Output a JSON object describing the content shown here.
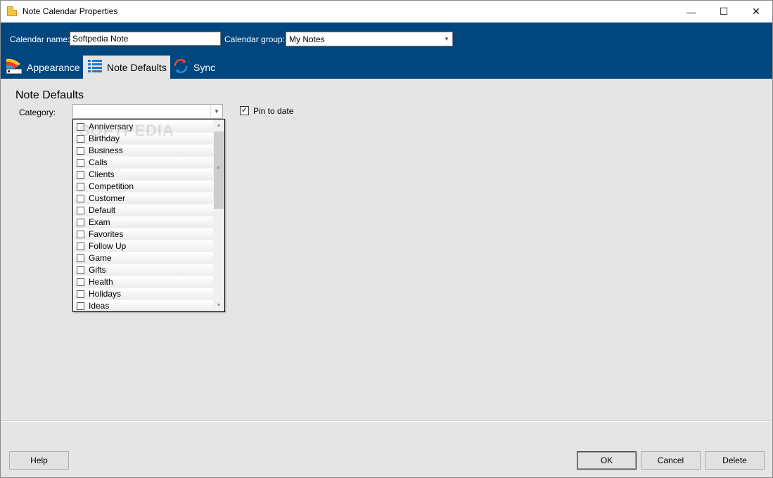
{
  "window": {
    "title": "Note Calendar Properties",
    "controls": {
      "minimize": "—",
      "maximize": "☐",
      "close": "✕"
    }
  },
  "header": {
    "calendar_name_label": "Calendar name:",
    "calendar_name_value": "Softpedia Note",
    "calendar_group_label": "Calendar group:",
    "calendar_group_value": "My Notes"
  },
  "tabs": [
    {
      "label": "Appearance",
      "icon": "palette-icon",
      "active": false
    },
    {
      "label": "Note Defaults",
      "icon": "list-icon",
      "active": true
    },
    {
      "label": "Sync",
      "icon": "sync-icon",
      "active": false
    }
  ],
  "content": {
    "section_title": "Note Defaults",
    "category_label": "Category:",
    "category_value": "",
    "pin_to_date_label": "Pin to date",
    "pin_to_date_checked": true,
    "categories": [
      {
        "label": "Anniversary",
        "checked": false
      },
      {
        "label": "Birthday",
        "checked": false
      },
      {
        "label": "Business",
        "checked": false
      },
      {
        "label": "Calls",
        "checked": false
      },
      {
        "label": "Clients",
        "checked": false
      },
      {
        "label": "Competition",
        "checked": false
      },
      {
        "label": "Customer",
        "checked": false
      },
      {
        "label": "Default",
        "checked": false
      },
      {
        "label": "Exam",
        "checked": false
      },
      {
        "label": "Favorites",
        "checked": false
      },
      {
        "label": "Follow Up",
        "checked": false
      },
      {
        "label": "Game",
        "checked": false
      },
      {
        "label": "Gifts",
        "checked": false
      },
      {
        "label": "Health",
        "checked": false
      },
      {
        "label": "Holidays",
        "checked": false
      },
      {
        "label": "Ideas",
        "checked": false
      }
    ],
    "watermark": "SOFTPEDIA"
  },
  "footer": {
    "help_label": "Help",
    "ok_label": "OK",
    "cancel_label": "Cancel",
    "delete_label": "Delete"
  },
  "colors": {
    "header_bg": "#00467f",
    "window_bg": "#e5e5e5"
  }
}
